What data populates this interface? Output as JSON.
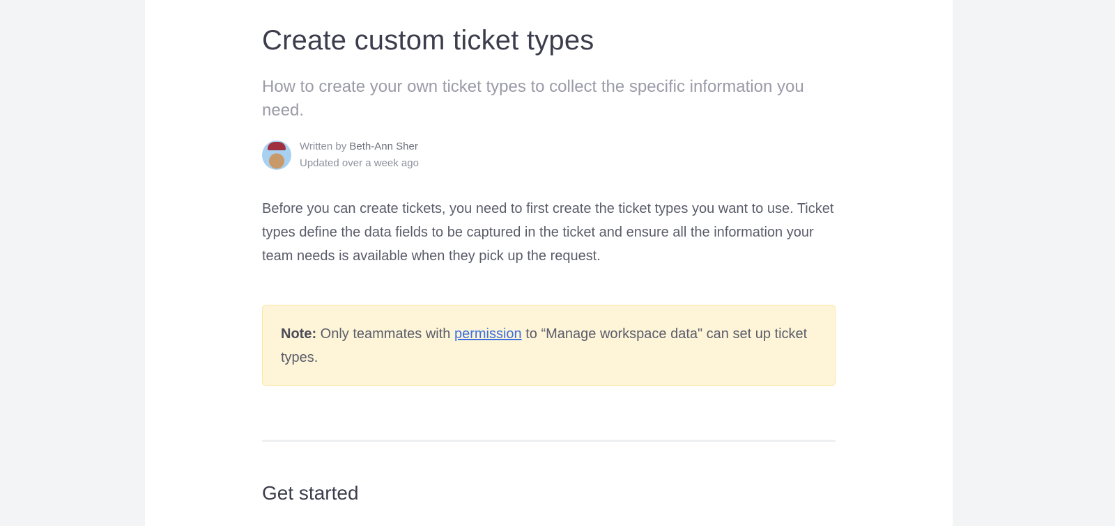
{
  "article": {
    "title": "Create custom ticket types",
    "subtitle": "How to create your own ticket types to collect the specific information you need.",
    "author_prefix": "Written by ",
    "author": "Beth-Ann Sher",
    "updated": "Updated over a week ago",
    "intro": "Before you can create tickets, you need to first create the ticket types you want to use. Ticket types define the data fields to be captured in the ticket and ensure all the information your team needs is available when they pick up the request.",
    "note": {
      "label": "Note:",
      "before": " Only teammates with ",
      "link": "permission",
      "after": " to “Manage workspace data\" can set up ticket types."
    },
    "section_heading": "Get started"
  }
}
